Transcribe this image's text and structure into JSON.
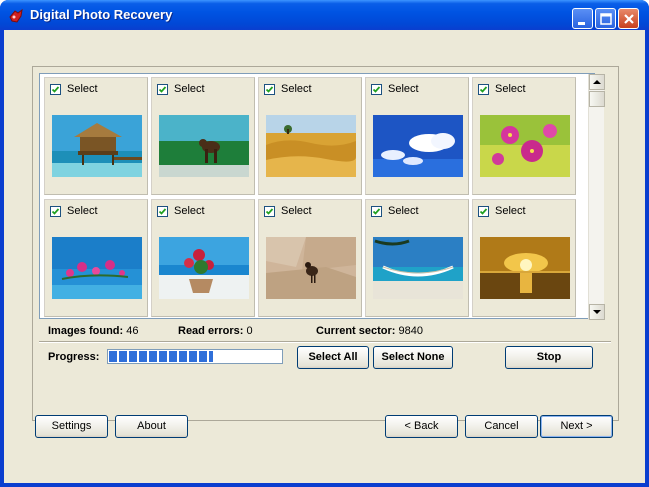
{
  "window": {
    "title": "Digital Photo Recovery"
  },
  "thumbnails": [
    {
      "label": "Select",
      "checked": true,
      "scene": "beach-hut"
    },
    {
      "label": "Select",
      "checked": true,
      "scene": "dog-lake"
    },
    {
      "label": "Select",
      "checked": true,
      "scene": "wheat-field"
    },
    {
      "label": "Select",
      "checked": true,
      "scene": "blue-sky-clouds"
    },
    {
      "label": "Select",
      "checked": true,
      "scene": "pink-flowers"
    },
    {
      "label": "Select",
      "checked": true,
      "scene": "flowers-sea"
    },
    {
      "label": "Select",
      "checked": true,
      "scene": "flower-pot-beach"
    },
    {
      "label": "Select",
      "checked": true,
      "scene": "bird-stones"
    },
    {
      "label": "Select",
      "checked": true,
      "scene": "hammock-beach"
    },
    {
      "label": "Select",
      "checked": true,
      "scene": "golden-sunset"
    }
  ],
  "status": {
    "images_found_label": "Images found:",
    "images_found_value": "46",
    "read_errors_label": "Read errors:",
    "read_errors_value": "0",
    "current_sector_label": "Current sector:",
    "current_sector_value": "9840"
  },
  "progress": {
    "label": "Progress:",
    "fraction": 0.6
  },
  "buttons": {
    "select_all": "Select All",
    "select_none": "Select None",
    "stop": "Stop",
    "settings": "Settings",
    "about": "About",
    "back": "< Back",
    "cancel": "Cancel",
    "next": "Next >"
  },
  "colors": {
    "titlebar": "#0054e3",
    "face": "#ece9d8",
    "progress": "#2f6fd9"
  },
  "icons": [
    "app-icon",
    "minimize-icon",
    "maximize-icon",
    "close-icon",
    "scroll-up-icon",
    "scroll-down-icon",
    "checkmark-icon"
  ]
}
